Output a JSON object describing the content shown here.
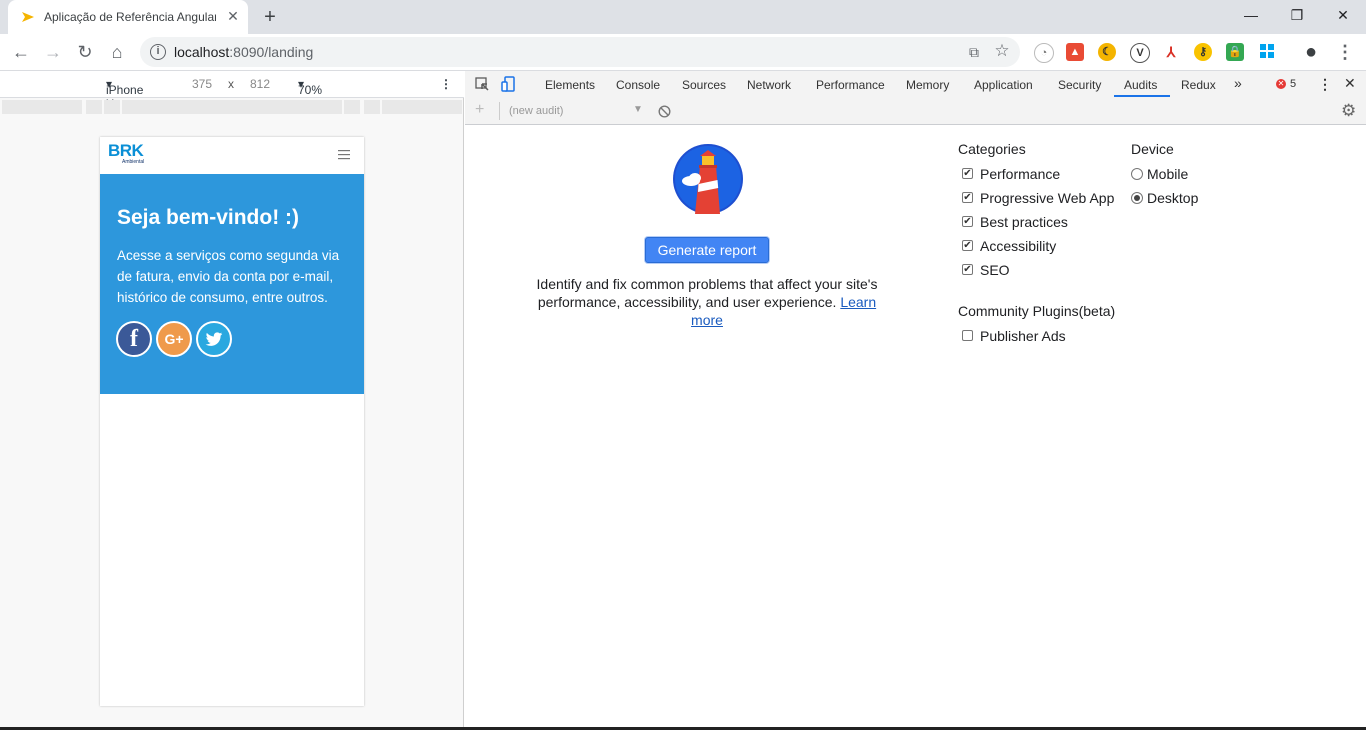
{
  "browser": {
    "tab_title": "Aplicação de Referência Angular",
    "tab_close": "✕",
    "new_tab": "+",
    "url_host": "localhost",
    "url_path": ":8090/landing",
    "window_controls": {
      "minimize": "—",
      "maximize": "❐",
      "close": "✕"
    }
  },
  "device_toolbar": {
    "device": "iPhone X",
    "width": "375",
    "times": "x",
    "height": "812",
    "zoom": "70%"
  },
  "app": {
    "logo_text": "BRK",
    "logo_subtext": "Ambiental",
    "hero_title": "Seja bem-vindo! :)",
    "hero_text": "Acesse a serviços como segunda via de fatura, envio da conta por e-mail, histórico de consumo, entre outros.",
    "social": [
      "facebook",
      "google-plus",
      "twitter"
    ],
    "social_labels": {
      "facebook": "f",
      "google": "G+",
      "twitter": "🐦"
    },
    "hero_color": "#2d97dc"
  },
  "devtools": {
    "tabs": [
      "Elements",
      "Console",
      "Sources",
      "Network",
      "Performance",
      "Memory",
      "Application",
      "Security",
      "Audits",
      "Redux"
    ],
    "active_tab": "Audits",
    "more_tabs": "»",
    "error_count": "5",
    "new_audit": "(new audit)",
    "generate_button": "Generate report",
    "description": "Identify and fix common problems that affect your site's performance, accessibility, and user experience.",
    "learn_more": "Learn more",
    "categories_title": "Categories",
    "categories": [
      {
        "label": "Performance",
        "checked": true
      },
      {
        "label": "Progressive Web App",
        "checked": true
      },
      {
        "label": "Best practices",
        "checked": true
      },
      {
        "label": "Accessibility",
        "checked": true
      },
      {
        "label": "SEO",
        "checked": true
      }
    ],
    "device_title": "Device",
    "devices": [
      {
        "label": "Mobile",
        "selected": false
      },
      {
        "label": "Desktop",
        "selected": true
      }
    ],
    "plugins_title": "Community Plugins(beta)",
    "plugins": [
      {
        "label": "Publisher Ads",
        "checked": false
      }
    ]
  }
}
